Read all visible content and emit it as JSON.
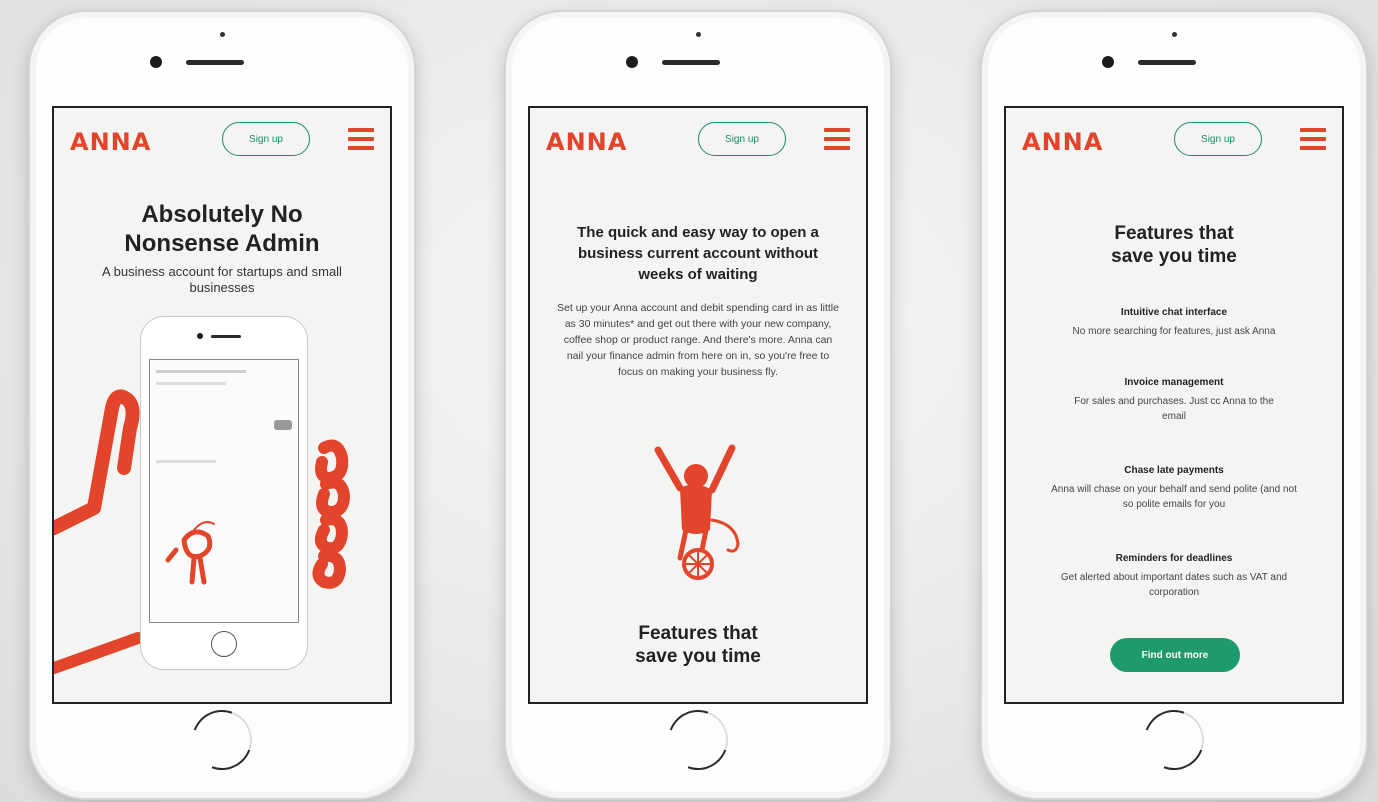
{
  "screens": [
    {
      "logo": "ANNA",
      "signup": "Sign up",
      "headline": "Absolutely No Nonsense Admin",
      "subline": "A business account for startups and small businesses"
    },
    {
      "logo": "ANNA",
      "signup": "Sign up",
      "headline": "The quick and easy way to open a business current account without weeks of waiting",
      "paragraph": "Set up your Anna account and debit spending card in as little as 30 minutes* and get out there with your new company, coffee shop or product range. And there's more. Anna can nail your finance admin from here on in, so you're free to focus on making your business fly.",
      "section_title": "Features that save you time"
    },
    {
      "logo": "ANNA",
      "signup": "Sign up",
      "section_title": "Features that save you time",
      "features": [
        {
          "title": "Intuitive chat interface",
          "desc": "No more searching for features, just ask Anna"
        },
        {
          "title": "Invoice management",
          "desc": "For sales and purchases. Just cc Anna to the email"
        },
        {
          "title": "Chase late payments",
          "desc": "Anna will chase on your behalf and send polite (and not so polite emails for you"
        },
        {
          "title": "Reminders for deadlines",
          "desc": "Get alerted about important dates such as VAT and corporation"
        }
      ],
      "cta": "Find out more"
    }
  ],
  "colors": {
    "brand_red": "#e2452b",
    "brand_green": "#1e9a6b"
  },
  "icons": [
    "menu-icon",
    "monkey-illustration",
    "bird-illustration"
  ]
}
